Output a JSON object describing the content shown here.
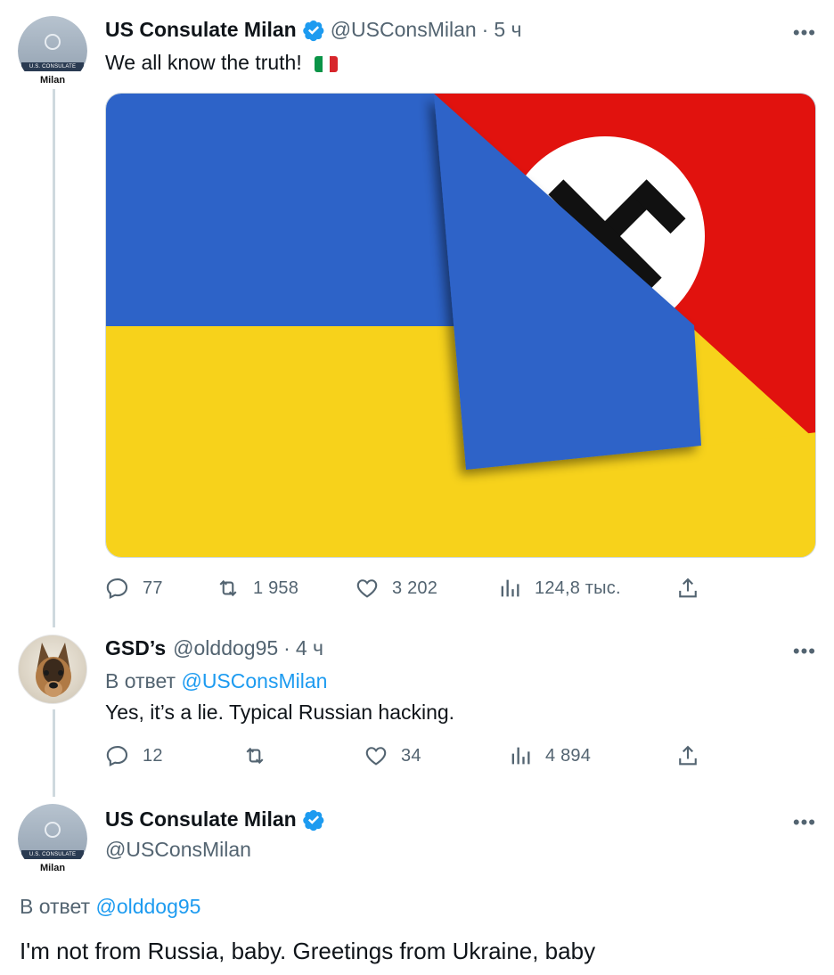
{
  "tweet1": {
    "name": "US Consulate Milan",
    "handle": "@USConsMilan",
    "separator": "·",
    "time": "5 ч",
    "text": "We all know the truth!",
    "emoji_flag_icon": "flag-italy-icon",
    "avatar": {
      "band": "U.S. CONSULATE",
      "city": "Milan"
    },
    "stats": {
      "replies": "77",
      "retweets": "1 958",
      "likes": "3 202",
      "views": "124,8 тыс."
    }
  },
  "tweet2": {
    "name": "GSD’s",
    "handle": "@olddog95",
    "separator": "·",
    "time": "4 ч",
    "reply_prefix": "В ответ",
    "reply_to": "@USConsMilan",
    "text": "Yes, it’s a lie. Typical Russian hacking.",
    "stats": {
      "replies": "12",
      "retweets": "",
      "likes": "34",
      "views": "4 894"
    }
  },
  "tweet3": {
    "name": "US Consulate Milan",
    "handle": "@USConsMilan",
    "avatar": {
      "band": "U.S. CONSULATE",
      "city": "Milan"
    },
    "reply_prefix": "В ответ",
    "reply_to": "@olddog95",
    "text": "I'm not from Russia, baby. Greetings from Ukraine, baby"
  },
  "more_label": "•••",
  "colors": {
    "verified": "#1d9bf0",
    "link": "#1d9bf0",
    "muted": "#536471",
    "ukraine_blue": "#2d63c8",
    "ukraine_yellow": "#f7d21b",
    "flag_red": "#e1120e"
  }
}
